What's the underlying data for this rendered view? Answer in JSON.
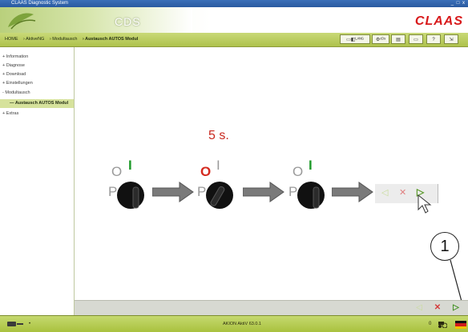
{
  "window": {
    "title": "CLAAS Diagnostic System",
    "controls": "_ □ x"
  },
  "header": {
    "app_name": "CDS",
    "brand": "CLAAS"
  },
  "breadcrumb": [
    "HOME",
    "› AktiveNG",
    "› Modultausch",
    "› Austausch AUTOS Modul"
  ],
  "toolbar": {
    "buttons": [
      {
        "name": "manual-button",
        "label": "▭◧ᴸᴬᴺᴳ"
      },
      {
        "name": "cds-button",
        "label": "⚙ᶜᴰˢ"
      },
      {
        "name": "doc-button",
        "label": "▤"
      },
      {
        "name": "info-button",
        "label": "▭"
      },
      {
        "name": "help-button",
        "label": "?"
      },
      {
        "name": "exit-button",
        "label": "⇲"
      }
    ]
  },
  "sidebar": {
    "items": [
      {
        "label": "+ Information",
        "sub": false
      },
      {
        "label": "+ Diagnose",
        "sub": false
      },
      {
        "label": "+ Download",
        "sub": false
      },
      {
        "label": "+ Einstellungen",
        "sub": false
      },
      {
        "label": "- Modultausch",
        "sub": false
      },
      {
        "label": "— Austausch AUTOS Modul",
        "sub": true
      },
      {
        "label": "+ Extras",
        "sub": false
      }
    ]
  },
  "diagram": {
    "timer": "5 s.",
    "switch_labels": {
      "off": "O",
      "on": "I",
      "park": "P"
    },
    "colors": {
      "active_on": "#1f9a2a",
      "active_off": "#d42a1f",
      "inactive": "#9a9a9a",
      "arrow": "#7a7a7a"
    }
  },
  "nav": {
    "back": "◁",
    "cancel": "✕",
    "next": "▷"
  },
  "annotation": {
    "number": "1"
  },
  "status": {
    "version": "AKION AktiV 63.0.1",
    "count": "0"
  }
}
